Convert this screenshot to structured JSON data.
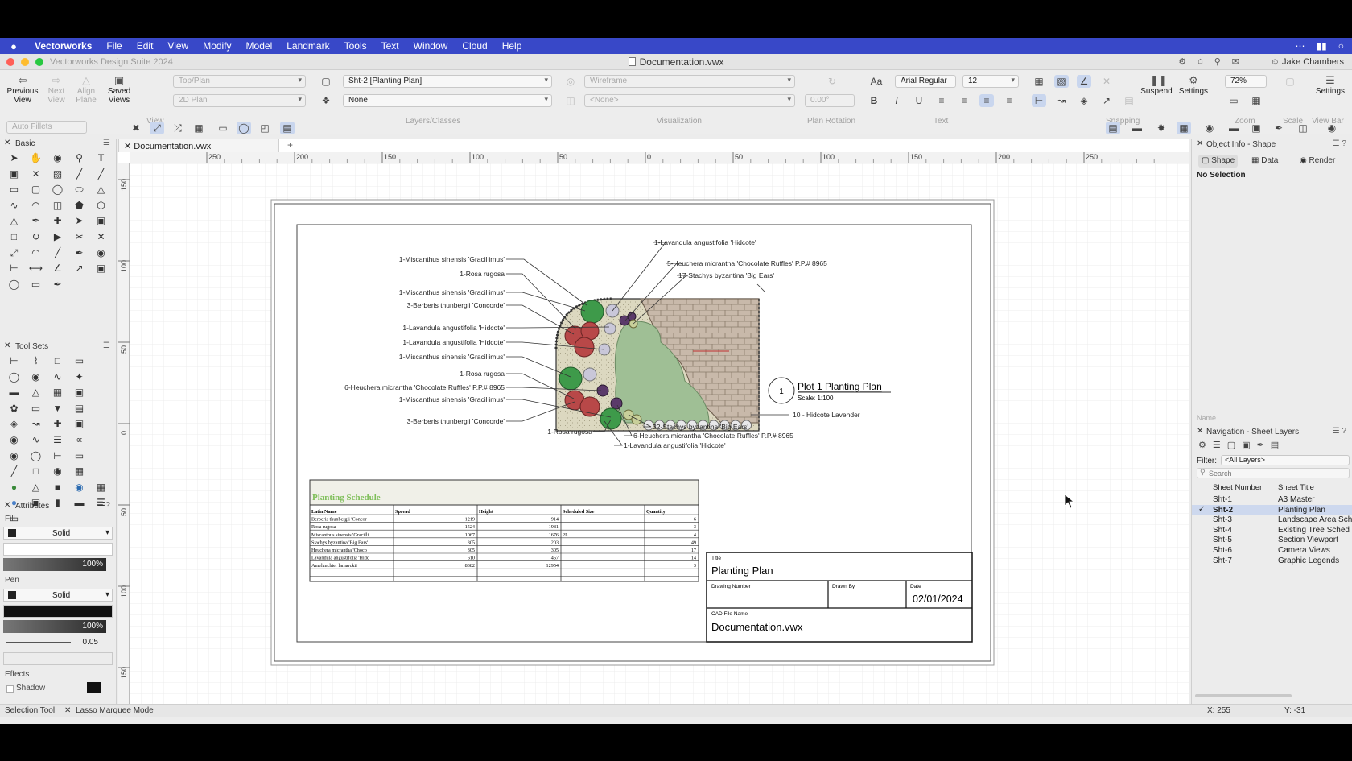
{
  "menubar": {
    "app_name": "Vectorworks",
    "items": [
      "File",
      "Edit",
      "View",
      "Modify",
      "Model",
      "Landmark",
      "Tools",
      "Text",
      "Window",
      "Cloud",
      "Help"
    ]
  },
  "window": {
    "app_title": "Vectorworks Design Suite 2024",
    "document_title": "Documentation.vwx",
    "user": "Jake Chambers"
  },
  "toolbar": {
    "previous_view": "Previous View",
    "next_view": "Next View",
    "align_plane": "Align Plane",
    "saved_views": "Saved Views",
    "view_mode": "Top/Plan",
    "plane_mode": "2D Plan",
    "sheet_layer": "Sht-2 [Planting Plan]",
    "class": "None",
    "render_mode": "Wireframe",
    "projection": "<None>",
    "plan_rotation": "0.00°",
    "font_name": "Arial Regular",
    "font_size": "12",
    "zoom": "72%",
    "suspend": "Suspend",
    "settings": "Settings",
    "settings2": "Settings",
    "group_view": "View",
    "group_layers": "Layers/Classes",
    "group_visualization": "Visualization",
    "group_plan_rotation": "Plan Rotation",
    "group_text": "Text",
    "group_snapping": "Snapping",
    "group_zoom": "Zoom",
    "group_scale": "Scale",
    "group_viewbar": "View Bar",
    "auto_fillets": "Auto Fillets"
  },
  "palettes": {
    "basic": "Basic",
    "tool_sets": "Tool Sets",
    "attributes": "Attributes",
    "fill_label": "Fill",
    "fill_style": "Solid",
    "fill_opacity": "100%",
    "pen_label": "Pen",
    "pen_style": "Solid",
    "pen_opacity": "100%",
    "line_weight": "0.05",
    "effects_label": "Effects",
    "shadow_label": "Shadow"
  },
  "document_tab": "Documentation.vwx",
  "ruler": {
    "h_ticks": [
      "250",
      "200",
      "150",
      "100",
      "50",
      "0",
      "50",
      "100",
      "150",
      "200",
      "250"
    ],
    "v_ticks": [
      "150",
      "100",
      "50",
      "0",
      "50",
      "100",
      "150"
    ]
  },
  "drawing": {
    "plant_labels_left": [
      "1-Miscanthus sinensis 'Gracillimus'",
      "1-Rosa rugosa",
      "1-Miscanthus sinensis 'Gracillimus'",
      "3-Berberis thunbergii 'Concorde'",
      "1-Lavandula angustifolia 'Hidcote'",
      "1-Lavandula angustifolia 'Hidcote'",
      "1-Miscanthus sinensis 'Gracillimus'",
      "1-Rosa rugosa",
      "6-Heuchera micrantha 'Chocolate Ruffles' P.P.# 8965",
      "1-Miscanthus sinensis 'Gracillimus'",
      "3-Berberis thunbergii 'Concorde'"
    ],
    "plant_labels_top": [
      "1-Lavandula angustifolia 'Hidcote'",
      "5-Heuchera micrantha 'Chocolate Ruffles' P.P.# 8965",
      "17-Stachys byzantina 'Big Ears'"
    ],
    "plant_labels_bottom": [
      "1-Rosa rugosa",
      "32-Stachys byzantina 'Big Ears'",
      "6-Heuchera micrantha 'Chocolate Ruffles' P.P.# 8965",
      "1-Lavandula angustifolia 'Hidcote'"
    ],
    "lavender_label": "10 - Hidcote Lavender",
    "plot_number": "1",
    "plot_title": "Plot 1 Planting Plan",
    "plot_scale": "Scale: 1:100",
    "schedule": {
      "title": "Planting Schedule",
      "columns": [
        "Latin Name",
        "Spread",
        "Height",
        "Scheduled Size",
        "Quantity"
      ],
      "rows": [
        [
          "Berberis thunbergii 'Concor",
          "1219",
          "914",
          "",
          "6"
        ],
        [
          "Rosa rugosa",
          "1524",
          "1981",
          "",
          "3"
        ],
        [
          "Miscanthus sinensis 'Gracilli",
          "1067",
          "1676",
          "2L",
          "4"
        ],
        [
          "Stachys byzantina 'Big Ears'",
          "305",
          "203",
          "",
          "49"
        ],
        [
          "Heuchera micrantha 'Choco",
          "305",
          "305",
          "",
          "17"
        ],
        [
          "Lavandula angustifolia 'Hidc",
          "610",
          "457",
          "",
          "14"
        ],
        [
          "Amelanchier lamarckii",
          "8382",
          "12954",
          "",
          "3"
        ]
      ]
    },
    "title_block": {
      "title_label": "Title",
      "title_value": "Planting Plan",
      "drawing_number_label": "Drawing Number",
      "drawn_by_label": "Drawn By",
      "date_label": "Date",
      "date_value": "02/01/2024",
      "cad_label": "CAD File Name",
      "cad_value": "Documentation.vwx"
    }
  },
  "object_info": {
    "header": "Object Info - Shape",
    "tabs": [
      "Shape",
      "Data",
      "Render"
    ],
    "selection": "No Selection",
    "name_label": "Name"
  },
  "navigation": {
    "header": "Navigation - Sheet Layers",
    "filter_label": "Filter:",
    "filter_value": "<All Layers>",
    "search_placeholder": "Search",
    "col_number": "Sheet Number",
    "col_title": "Sheet Title",
    "sheets": [
      {
        "number": "Sht-1",
        "title": "A3 Master",
        "active": false
      },
      {
        "number": "Sht-2",
        "title": "Planting Plan",
        "active": true
      },
      {
        "number": "Sht-3",
        "title": "Landscape Area Sch",
        "active": false
      },
      {
        "number": "Sht-4",
        "title": "Existing Tree Sched",
        "active": false
      },
      {
        "number": "Sht-5",
        "title": "Section Viewport",
        "active": false
      },
      {
        "number": "Sht-6",
        "title": "Camera Views",
        "active": false
      },
      {
        "number": "Sht-7",
        "title": "Graphic Legends",
        "active": false
      }
    ]
  },
  "status": {
    "tool": "Selection Tool",
    "mode": "Lasso Marquee Mode",
    "x": "X: 255",
    "y": "Y: -31"
  },
  "colors": {
    "menubar": "#3848c8",
    "schedule_title": "#7fbf5a",
    "selection": "#cdd8ee",
    "planting_bed": "#dcd8c0",
    "lawn": "#9fbf95",
    "paving": "#c8b9aa"
  }
}
